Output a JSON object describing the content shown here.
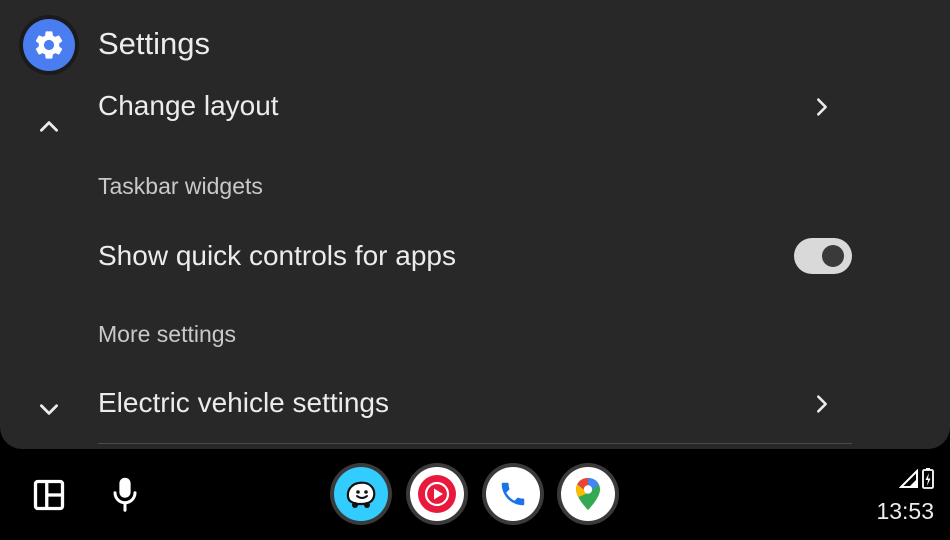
{
  "header": {
    "title": "Settings",
    "app_icon": "gear-icon"
  },
  "settings": {
    "change_layout": "Change layout",
    "taskbar_widgets_header": "Taskbar widgets",
    "quick_controls": "Show quick controls for apps",
    "quick_controls_enabled": true,
    "more_settings_header": "More settings",
    "ev_settings": "Electric vehicle settings"
  },
  "taskbar": {
    "apps": [
      "waze-icon",
      "youtube-music-icon",
      "phone-icon",
      "google-maps-icon"
    ],
    "clock": "13:53"
  },
  "colors": {
    "background": "#000000",
    "card": "#282828",
    "accent_blue": "#4a7df0",
    "waze": "#33ccff",
    "youtube_music": "#e8193c",
    "phone": "#1a73e8"
  }
}
